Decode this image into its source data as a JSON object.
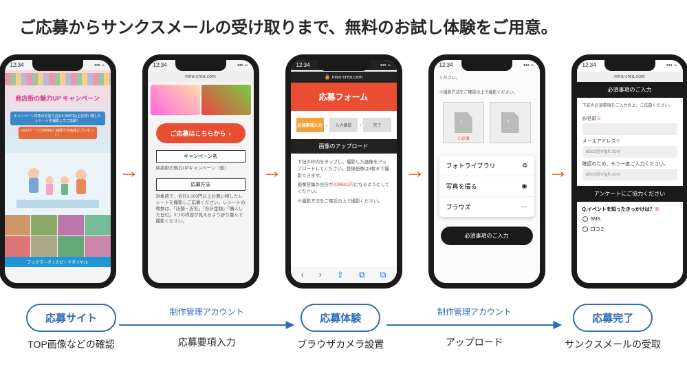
{
  "headline": "ご応募からサンクスメールの受け取りまで、無料のお試し体験をご用意。",
  "status_time": "12:34",
  "arrow_glyph": "→",
  "phone1": {
    "banner_title": "商店街の魅力UP キャンペーン",
    "banner_sub1": "キャンペーン対象のお店で合計3,000円以上お買い物したレシートを撮影してご応募！",
    "banner_sub2": "QUOカード3,000円分 抽選で10名様にプレゼント！",
    "address_bar": "ブックマーク / スピードダイヤル"
  },
  "phone2": {
    "url": "mira-crea.com",
    "cta": "ご応募はこちらから",
    "section1_label": "キャンペーン名",
    "section1_text": "商店街の魅力UPキャンペーン（仮）",
    "section2_label": "応募方法",
    "section2_text": "対象店で、合計3,000円以上お買い物したレシートを撮影しご応募ください。レシートの枚数は、「店舗・店名」「合計金額」「購入した日付」3つの内容が見えるよう折り畳んで撮影ください。"
  },
  "phone3": {
    "url": "mira-crea.com",
    "form_title": "応募フォーム",
    "steps": [
      "必須事項入力",
      "入力確認",
      "完了"
    ],
    "upload_header": "画像のアップロード",
    "upload_text1": "下記の枠内をタップし、撮影した画像をアップロードしてください。登録画像は4枚まで撮影できます。",
    "upload_text2_a": "画像容量の合計が",
    "upload_text2_b": "20MB以内",
    "upload_text2_c": "になるようにしてください。",
    "upload_text3": "※撮影方法をご確認の上で撮影ください。",
    "nav_icons": [
      "‹",
      "›",
      "⇪",
      "⧉",
      "⧉"
    ]
  },
  "phone4": {
    "note1": "ください。",
    "note2": "※撮影方法をご確認の上で撮影ください。",
    "req_label": "※必須",
    "menu": [
      {
        "label": "フォトライブラリ",
        "icon": "⧉"
      },
      {
        "label": "写真を撮る",
        "icon": "◉"
      },
      {
        "label": "ブラウズ",
        "icon": "⋯"
      }
    ],
    "dark_button": "必須事項のご入力"
  },
  "phone5": {
    "url": "mira-crea.com",
    "req_header": "必須事項のご入力",
    "lead": "下記の必須事項をご入力の上、ご応募ください。",
    "name_label": "お名前",
    "email_label": "メールアドレス",
    "email_placeholder": "abcd@efgh.com",
    "email_confirm_label": "確認のため、もう一度ご入力ください。",
    "email_confirm_placeholder": "abcd@efgh.com",
    "survey_header": "アンケートにご協力ください",
    "q1": "Q.イベントを知ったきっかけは？",
    "opt1": "SNS",
    "opt2": "口コミ",
    "ast": "※"
  },
  "flow": {
    "node1": {
      "oval": "応募サイト",
      "sub": "TOP画像などの確認"
    },
    "arrow1": {
      "top": "制作管理アカウント",
      "sub": "応募要項入力"
    },
    "node2": {
      "oval": "応募体験",
      "sub": "ブラウザカメラ設置"
    },
    "arrow2": {
      "top": "制作管理アカウント",
      "sub": "アップロード"
    },
    "node3": {
      "oval": "応募完了",
      "sub": "サンクスメールの受取"
    }
  }
}
